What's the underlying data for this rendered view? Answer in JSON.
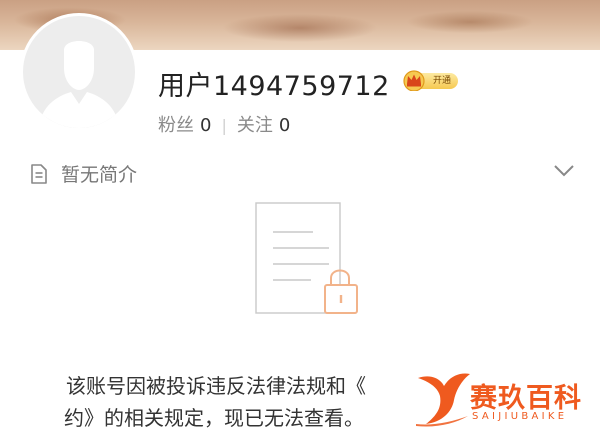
{
  "profile": {
    "username": "用户1494759712",
    "vip_badge": "开通",
    "followers_label": "粉丝",
    "followers_count": "0",
    "following_label": "关注",
    "following_count": "0",
    "avatar_icon": "default-avatar-silhouette"
  },
  "intro": {
    "text": "暂无简介",
    "icon": "document-icon",
    "expand_icon": "chevron-down-icon"
  },
  "notice": {
    "icon": "locked-document-icon",
    "line1": "该账号因被投诉违反法律法规和《",
    "line2": "约》的相关规定，现已无法查看。"
  },
  "watermark": {
    "title": "赛玖百科",
    "subtitle": "SAIJIUBAIKE"
  },
  "colors": {
    "accent_orange": "#ef5a1f",
    "lock_orange": "#f2b38a",
    "vip_gold": "#f6c951"
  }
}
